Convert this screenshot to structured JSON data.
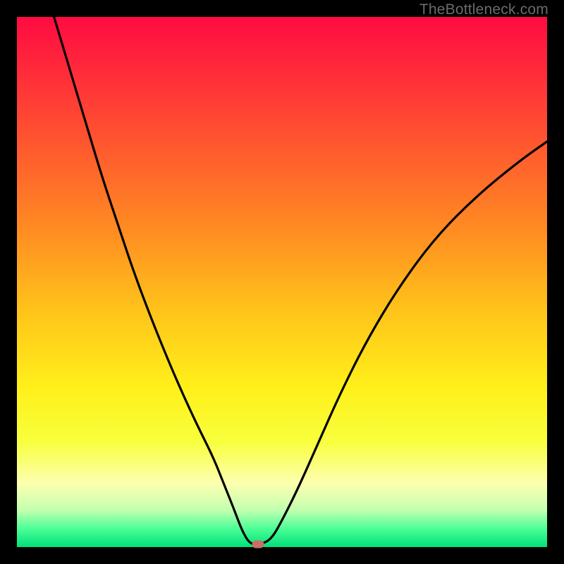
{
  "watermark": "TheBottleneck.com",
  "colors": {
    "black": "#000000",
    "curve": "#000000",
    "marker": "#ca6f63",
    "gradient_stops": [
      {
        "offset": 0.0,
        "color": "#ff0b42"
      },
      {
        "offset": 0.1,
        "color": "#ff2a3a"
      },
      {
        "offset": 0.25,
        "color": "#ff5a2e"
      },
      {
        "offset": 0.4,
        "color": "#ff8b22"
      },
      {
        "offset": 0.55,
        "color": "#ffc21a"
      },
      {
        "offset": 0.7,
        "color": "#fff01a"
      },
      {
        "offset": 0.8,
        "color": "#f8ff3c"
      },
      {
        "offset": 0.88,
        "color": "#fdffb0"
      },
      {
        "offset": 0.93,
        "color": "#c3ffb0"
      },
      {
        "offset": 0.965,
        "color": "#4dff97"
      },
      {
        "offset": 1.0,
        "color": "#00e07a"
      }
    ]
  },
  "chart_data": {
    "type": "line",
    "title": "",
    "xlabel": "",
    "ylabel": "",
    "xlim": [
      0,
      100
    ],
    "ylim": [
      0,
      100
    ],
    "grid": false,
    "series": [
      {
        "name": "bottleneck-curve",
        "x": [
          7,
          10,
          13,
          16,
          19,
          22,
          25,
          28,
          31,
          34,
          37,
          39,
          41,
          42.5,
          44,
          46,
          48,
          50,
          53,
          57,
          61,
          66,
          72,
          79,
          87,
          95,
          100
        ],
        "y": [
          100,
          90,
          80,
          70,
          61,
          52,
          44,
          36.5,
          29.5,
          23,
          17,
          12,
          7,
          3,
          0.5,
          0.5,
          1.5,
          5,
          11,
          20,
          29,
          39,
          49,
          58.5,
          66.5,
          73,
          76.5
        ]
      }
    ],
    "flat_segment": {
      "x_start": 42.5,
      "x_end": 46,
      "y": 0.5
    },
    "marker": {
      "x": 45.5,
      "y": 0.5
    },
    "annotations": []
  }
}
